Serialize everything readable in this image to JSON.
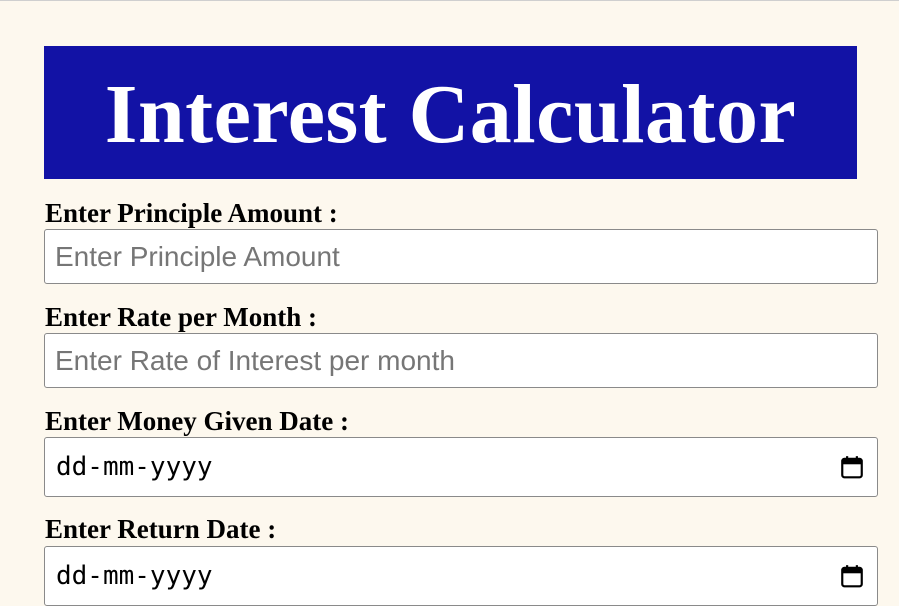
{
  "header": {
    "title": "Interest Calculator"
  },
  "form": {
    "principal": {
      "label": "Enter Principle Amount :",
      "placeholder": "Enter Principle Amount",
      "value": ""
    },
    "rate": {
      "label": "Enter Rate per Month :",
      "placeholder": "Enter Rate of Interest per month",
      "value": ""
    },
    "given_date": {
      "label": "Enter Money Given Date :",
      "display": "dd-mm-yyyy",
      "icon": "calendar-icon"
    },
    "return_date": {
      "label": "Enter Return Date :",
      "display": "dd-mm-yyyy",
      "icon": "calendar-icon"
    }
  },
  "colors": {
    "page_background": "#fdf8ee",
    "title_background": "#1212a5",
    "title_text": "#ffffff",
    "placeholder_text": "#767676"
  }
}
